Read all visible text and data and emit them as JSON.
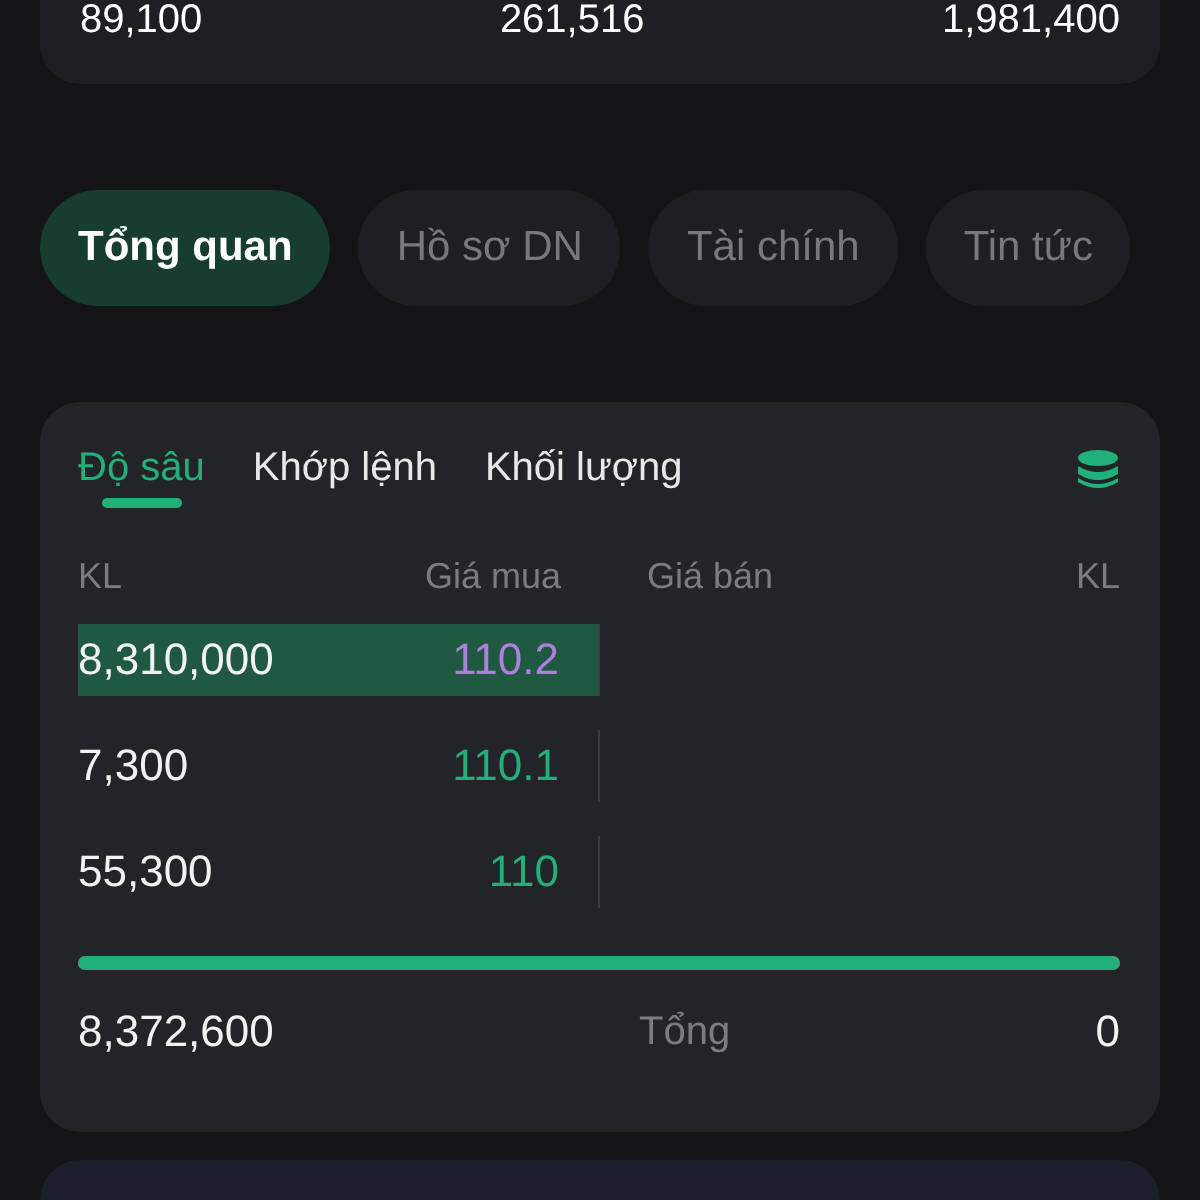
{
  "summary": [
    "89,100",
    "261,516",
    "1,981,400"
  ],
  "tabs": [
    {
      "label": "Tổng quan",
      "selected": true
    },
    {
      "label": "Hồ sơ DN",
      "selected": false
    },
    {
      "label": "Tài chính",
      "selected": false
    },
    {
      "label": "Tin tức",
      "selected": false
    }
  ],
  "depth": {
    "tabs": [
      {
        "label": "Độ sâu",
        "selected": true
      },
      {
        "label": "Khớp lệnh",
        "selected": false
      },
      {
        "label": "Khối lượng",
        "selected": false
      }
    ],
    "columns": [
      "KL",
      "Giá mua",
      "Giá bán",
      "KL"
    ],
    "bids": [
      {
        "volume": "8,310,000",
        "price": "110.2",
        "color": "#b07ee0",
        "level": 1
      },
      {
        "volume": "7,300",
        "price": "110.1",
        "color": "#22b07a",
        "level": 0
      },
      {
        "volume": "55,300",
        "price": "110",
        "color": "#22b07a",
        "level": 0
      }
    ],
    "balance": {
      "level": 1
    },
    "total_bid": "8,372,600",
    "total_label": "Tổng",
    "total_ask": "0"
  }
}
